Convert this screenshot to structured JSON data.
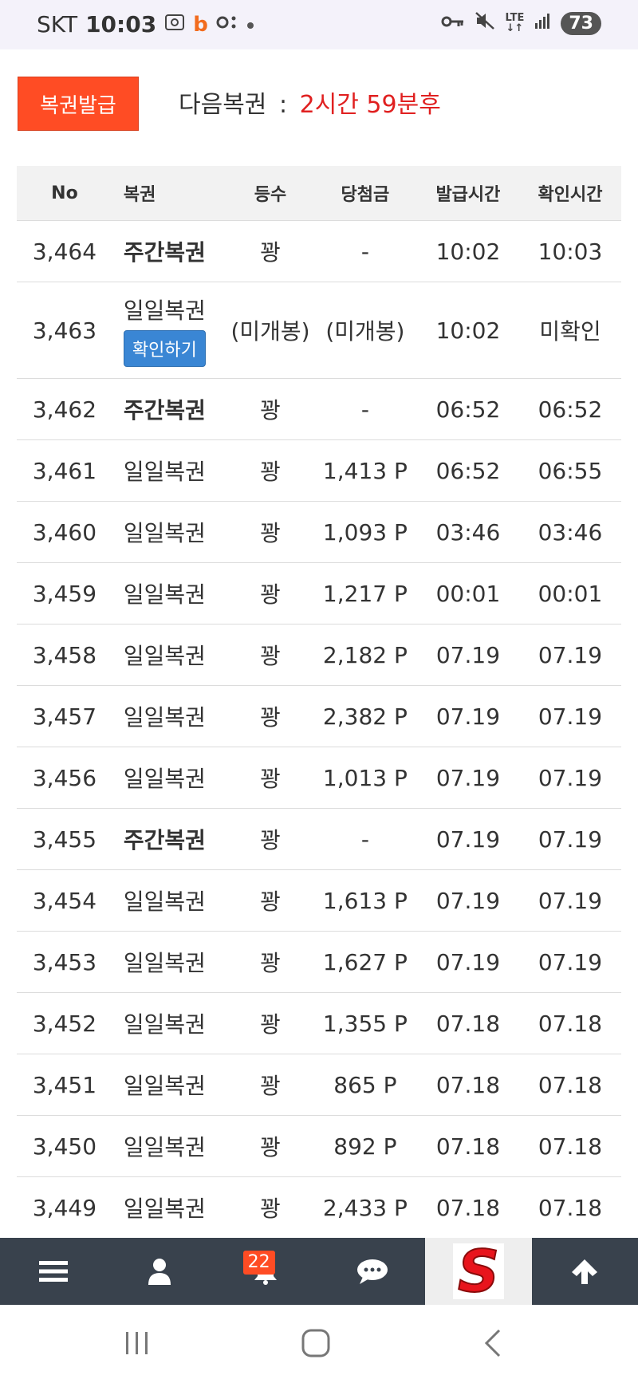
{
  "status_bar": {
    "carrier": "SKT",
    "time": "10:03",
    "network": "LTE",
    "battery": "73"
  },
  "header": {
    "issue_button_label": "복권발급",
    "next_label": "다음복권",
    "next_separator": ":",
    "next_time": "2시간 59분후"
  },
  "table": {
    "columns": [
      "No",
      "복권",
      "등수",
      "당첨금",
      "발급시간",
      "확인시간"
    ],
    "rows": [
      {
        "no": "3,464",
        "name": "주간복권",
        "rank": "꽝",
        "prize": "-",
        "issued": "10:02",
        "checked": "10:03"
      },
      {
        "no": "3,463",
        "name": "일일복권",
        "confirm_label": "확인하기",
        "rank": "(미개봉)",
        "prize": "(미개봉)",
        "issued": "10:02",
        "checked": "미확인"
      },
      {
        "no": "3,462",
        "name": "주간복권",
        "rank": "꽝",
        "prize": "-",
        "issued": "06:52",
        "checked": "06:52"
      },
      {
        "no": "3,461",
        "name": "일일복권",
        "rank": "꽝",
        "prize": "1,413 P",
        "issued": "06:52",
        "checked": "06:55"
      },
      {
        "no": "3,460",
        "name": "일일복권",
        "rank": "꽝",
        "prize": "1,093 P",
        "issued": "03:46",
        "checked": "03:46"
      },
      {
        "no": "3,459",
        "name": "일일복권",
        "rank": "꽝",
        "prize": "1,217 P",
        "issued": "00:01",
        "checked": "00:01"
      },
      {
        "no": "3,458",
        "name": "일일복권",
        "rank": "꽝",
        "prize": "2,182 P",
        "issued": "07.19",
        "checked": "07.19"
      },
      {
        "no": "3,457",
        "name": "일일복권",
        "rank": "꽝",
        "prize": "2,382 P",
        "issued": "07.19",
        "checked": "07.19"
      },
      {
        "no": "3,456",
        "name": "일일복권",
        "rank": "꽝",
        "prize": "1,013 P",
        "issued": "07.19",
        "checked": "07.19"
      },
      {
        "no": "3,455",
        "name": "주간복권",
        "rank": "꽝",
        "prize": "-",
        "issued": "07.19",
        "checked": "07.19"
      },
      {
        "no": "3,454",
        "name": "일일복권",
        "rank": "꽝",
        "prize": "1,613 P",
        "issued": "07.19",
        "checked": "07.19"
      },
      {
        "no": "3,453",
        "name": "일일복권",
        "rank": "꽝",
        "prize": "1,627 P",
        "issued": "07.19",
        "checked": "07.19"
      },
      {
        "no": "3,452",
        "name": "일일복권",
        "rank": "꽝",
        "prize": "1,355 P",
        "issued": "07.18",
        "checked": "07.18"
      },
      {
        "no": "3,451",
        "name": "일일복권",
        "rank": "꽝",
        "prize": "865 P",
        "issued": "07.18",
        "checked": "07.18"
      },
      {
        "no": "3,450",
        "name": "일일복권",
        "rank": "꽝",
        "prize": "892 P",
        "issued": "07.18",
        "checked": "07.18"
      },
      {
        "no": "3,449",
        "name": "일일복권",
        "rank": "꽝",
        "prize": "2,433 P",
        "issued": "07.18",
        "checked": "07.18"
      }
    ]
  },
  "bottom_nav": {
    "notification_count": "22",
    "logo_letter": "S",
    "icons": [
      "menu-icon",
      "user-icon",
      "bell-icon",
      "chat-icon",
      "site-logo",
      "arrow-up-icon"
    ]
  },
  "colors": {
    "accent_orange": "#ff4c24",
    "next_time_red": "#e02020",
    "confirm_blue": "#3a86d4",
    "unconfirmed_amber": "#f0a020",
    "nav_bg": "#39424d"
  }
}
